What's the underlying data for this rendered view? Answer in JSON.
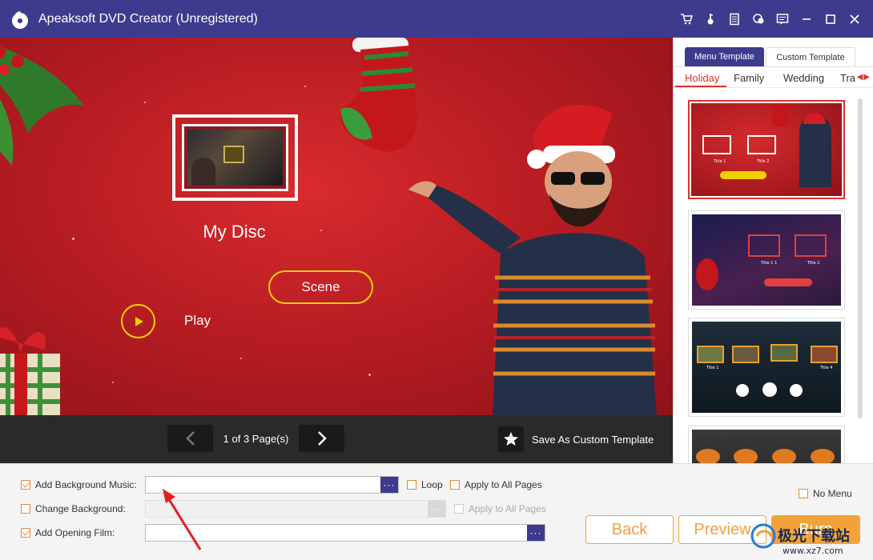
{
  "window": {
    "title": "Apeaksoft DVD Creator (Unregistered)",
    "controls": [
      "cart-icon",
      "key-icon",
      "document-icon",
      "chat-icon",
      "feedback-icon",
      "minimize-icon",
      "maximize-icon",
      "close-icon"
    ]
  },
  "preview": {
    "disc_title": "My Disc",
    "scene_button": "Scene",
    "play_label": "Play"
  },
  "pagination": {
    "info": "1 of 3 Page(s)",
    "save_template": "Save As Custom Template"
  },
  "template_panel": {
    "tabs": [
      "Menu Template",
      "Custom Template"
    ],
    "active_tab": "Menu Template",
    "categories": [
      "Holiday",
      "Family",
      "Wedding",
      "Tra"
    ],
    "active_category": "Holiday",
    "templates": [
      {
        "name": "christmas-man",
        "selected": true,
        "caption_1": "Title 1",
        "caption_2": "Title 2"
      },
      {
        "name": "space-santa",
        "selected": false,
        "caption_1": "Title 1 1",
        "caption_2": "Title 2"
      },
      {
        "name": "halloween-forest",
        "selected": false,
        "caption_1": "Title 1",
        "caption_2": "Title 4"
      },
      {
        "name": "halloween-pumpkins",
        "selected": false
      }
    ]
  },
  "options": {
    "bg_music": {
      "label": "Add Background Music:",
      "checked": true,
      "value": "",
      "browse": "···"
    },
    "loop": {
      "label": "Loop",
      "checked": false
    },
    "apply_all_music": {
      "label": "Apply to All Pages",
      "checked": false
    },
    "change_bg": {
      "label": "Change Background:",
      "checked": false,
      "value": "",
      "browse": "···"
    },
    "apply_all_bg": {
      "label": "Apply to All Pages",
      "checked": false,
      "disabled": true
    },
    "opening_film": {
      "label": "Add Opening Film:",
      "checked": true,
      "value": "",
      "browse": "···"
    },
    "no_menu": {
      "label": "No Menu",
      "checked": false
    }
  },
  "actions": {
    "back": "Back",
    "preview": "Preview",
    "burn": "Burn"
  },
  "colors": {
    "titlebar": "#3d3b8e",
    "accent_orange": "#f3a23a",
    "accent_red": "#e0322a",
    "button_yellow": "#f0d000"
  },
  "watermark": {
    "text": "极光下载站",
    "url": "www.xz7.com"
  }
}
